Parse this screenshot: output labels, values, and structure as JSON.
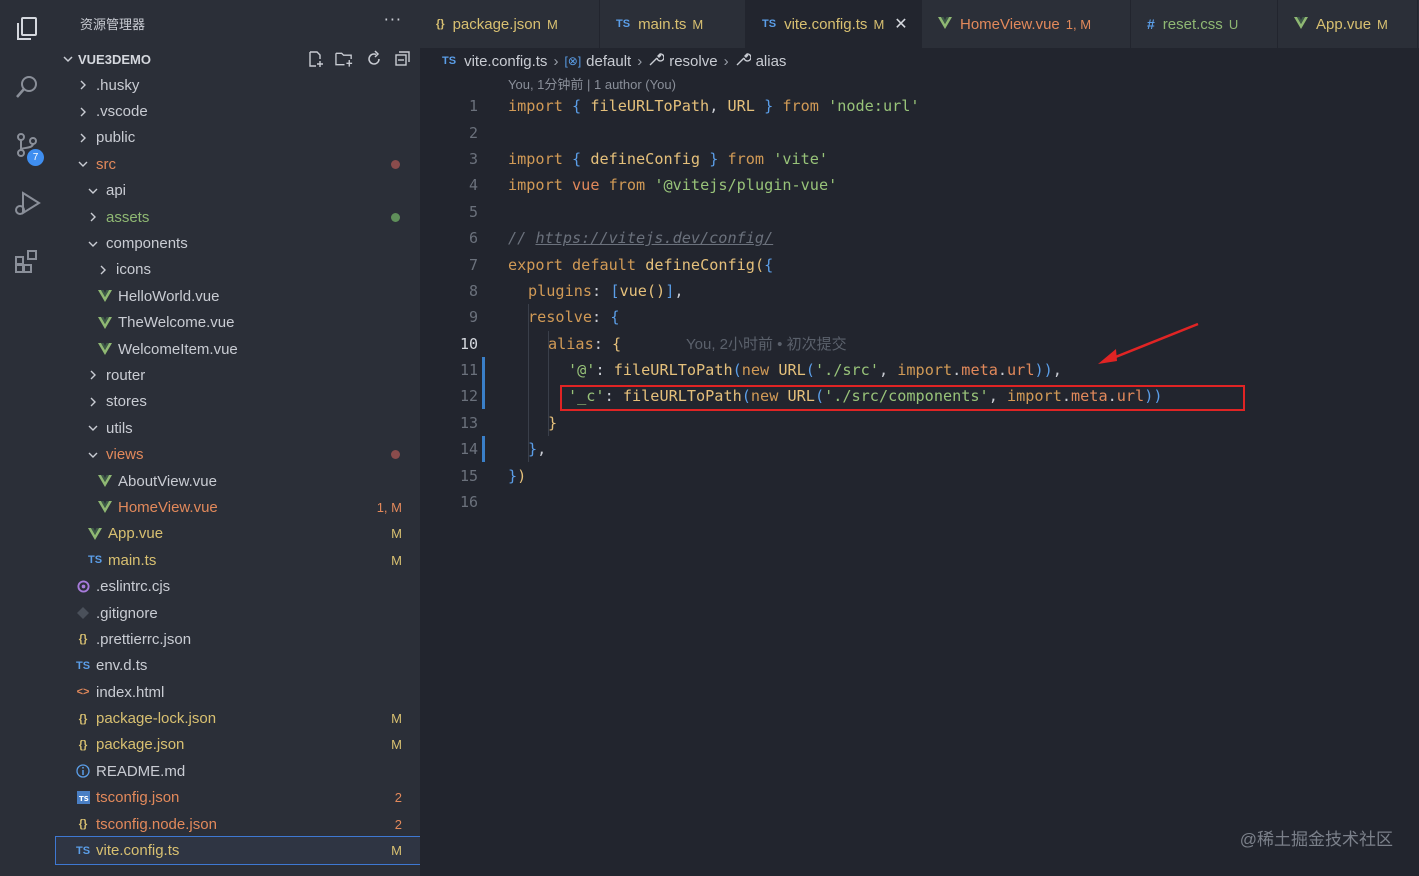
{
  "explorer": {
    "title": "资源管理器",
    "more": "···",
    "root": "VUE3DEMO",
    "items": [
      {
        "label": ".husky",
        "kind": "folder",
        "open": false,
        "depth": 1
      },
      {
        "label": ".vscode",
        "kind": "folder",
        "open": false,
        "depth": 1
      },
      {
        "label": "public",
        "kind": "folder",
        "open": false,
        "depth": 1
      },
      {
        "label": "src",
        "kind": "folder",
        "open": true,
        "depth": 1,
        "decoration": "dot-red"
      },
      {
        "label": "api",
        "kind": "folder",
        "open": true,
        "depth": 2
      },
      {
        "label": "assets",
        "kind": "folder",
        "open": false,
        "depth": 2,
        "decoration": "dot-green"
      },
      {
        "label": "components",
        "kind": "folder",
        "open": true,
        "depth": 2
      },
      {
        "label": "icons",
        "kind": "folder",
        "open": false,
        "depth": 3
      },
      {
        "label": "HelloWorld.vue",
        "kind": "vue",
        "depth": 3
      },
      {
        "label": "TheWelcome.vue",
        "kind": "vue",
        "depth": 3
      },
      {
        "label": "WelcomeItem.vue",
        "kind": "vue",
        "depth": 3
      },
      {
        "label": "router",
        "kind": "folder",
        "open": false,
        "depth": 2
      },
      {
        "label": "stores",
        "kind": "folder",
        "open": false,
        "depth": 2
      },
      {
        "label": "utils",
        "kind": "folder",
        "open": true,
        "depth": 2
      },
      {
        "label": "views",
        "kind": "folder",
        "open": true,
        "depth": 2,
        "decoration": "dot-red"
      },
      {
        "label": "AboutView.vue",
        "kind": "vue",
        "depth": 3
      },
      {
        "label": "HomeView.vue",
        "kind": "vue",
        "depth": 3,
        "status": "1, M"
      },
      {
        "label": "App.vue",
        "kind": "vue",
        "depth": 2,
        "status": "M"
      },
      {
        "label": "main.ts",
        "kind": "ts",
        "depth": 2,
        "status": "M"
      },
      {
        "label": ".eslintrc.cjs",
        "kind": "eslint",
        "depth": 1
      },
      {
        "label": ".gitignore",
        "kind": "git",
        "depth": 1
      },
      {
        "label": ".prettierrc.json",
        "kind": "json",
        "depth": 1
      },
      {
        "label": "env.d.ts",
        "kind": "ts",
        "depth": 1
      },
      {
        "label": "index.html",
        "kind": "html",
        "depth": 1
      },
      {
        "label": "package-lock.json",
        "kind": "json",
        "depth": 1,
        "status": "M"
      },
      {
        "label": "package.json",
        "kind": "json",
        "depth": 1,
        "status": "M"
      },
      {
        "label": "README.md",
        "kind": "info",
        "depth": 1
      },
      {
        "label": "tsconfig.json",
        "kind": "tsconfig",
        "depth": 1,
        "status": "2"
      },
      {
        "label": "tsconfig.node.json",
        "kind": "json",
        "depth": 1,
        "status": "2"
      },
      {
        "label": "vite.config.ts",
        "kind": "ts",
        "depth": 1,
        "status": "M",
        "active": true
      }
    ]
  },
  "activity": {
    "source_control_badge": "7"
  },
  "tabs": [
    {
      "label": "package.json",
      "icon": "{}",
      "status": "M"
    },
    {
      "label": "main.ts",
      "icon": "TS",
      "status": "M"
    },
    {
      "label": "vite.config.ts",
      "icon": "TS",
      "status": "M",
      "active": true
    },
    {
      "label": "HomeView.vue",
      "icon": "V",
      "status": "1, M"
    },
    {
      "label": "reset.css",
      "icon": "#",
      "status": "U"
    },
    {
      "label": "App.vue",
      "icon": "V",
      "status": "M"
    }
  ],
  "breadcrumb": {
    "file_icon": "TS",
    "file": "vite.config.ts",
    "default": "default",
    "resolve": "resolve",
    "alias": "alias"
  },
  "blame_header": "You, 1分钟前 | 1 author (You)",
  "inline_blame": "You, 2小时前 • 初次提交",
  "line_numbers": [
    "1",
    "2",
    "3",
    "4",
    "5",
    "6",
    "7",
    "8",
    "9",
    "10",
    "11",
    "12",
    "13",
    "14",
    "15",
    "16"
  ],
  "code": {
    "l1": {
      "a": "import",
      "b": " { ",
      "c": "fileURLToPath",
      "d": ", ",
      "e": "URL",
      "f": " } ",
      "g": "from",
      "h": " ",
      "i": "'node:url'"
    },
    "l3": {
      "a": "import",
      "b": " { ",
      "c": "defineConfig",
      "d": " } ",
      "e": "from",
      "f": " ",
      "g": "'vite'"
    },
    "l4": {
      "a": "import",
      "b": " ",
      "c": "vue",
      "d": " ",
      "e": "from",
      "f": " ",
      "g": "'@vitejs/plugin-vue'"
    },
    "l6": {
      "a": "// ",
      "b": "https://vitejs.dev/config/"
    },
    "l7": {
      "a": "export",
      "b": " ",
      "c": "default",
      "d": " ",
      "e": "defineConfig",
      "f": "(",
      "g": "{"
    },
    "l8": {
      "a": "plugins",
      "b": ": ",
      "c": "[",
      "d": "vue",
      "e": "()",
      "f": "]",
      "g": ","
    },
    "l9": {
      "a": "resolve",
      "b": ": ",
      "c": "{"
    },
    "l10": {
      "a": "alias",
      "b": ": ",
      "c": "{"
    },
    "l11": {
      "a": "'@'",
      "b": ": ",
      "c": "fileURLToPath",
      "d": "(",
      "e": "new",
      "f": " ",
      "g": "URL",
      "h": "(",
      "i": "'./src'",
      "j": ", ",
      "k": "import",
      "l": ".",
      "m": "meta",
      "n": ".",
      "o": "url",
      "p": "))",
      "q": ","
    },
    "l12": {
      "a": "'_c'",
      "b": ": ",
      "c": "fileURLToPath",
      "d": "(",
      "e": "new",
      "f": " ",
      "g": "URL",
      "h": "(",
      "i": "'./src/components'",
      "j": ", ",
      "k": "import",
      "l": ".",
      "m": "meta",
      "n": ".",
      "o": "url",
      "p": "))"
    },
    "l13": {
      "a": "}"
    },
    "l14": {
      "a": "}",
      "b": ","
    },
    "l15": {
      "a": "}",
      "b": ")"
    }
  },
  "watermark": "@稀土掘金技术社区",
  "colors": {
    "accent": "#3e78d2",
    "modified": "#d8c071",
    "error": "#e2895b",
    "untracked": "#8fb873",
    "highlight_box": "#e02424"
  }
}
